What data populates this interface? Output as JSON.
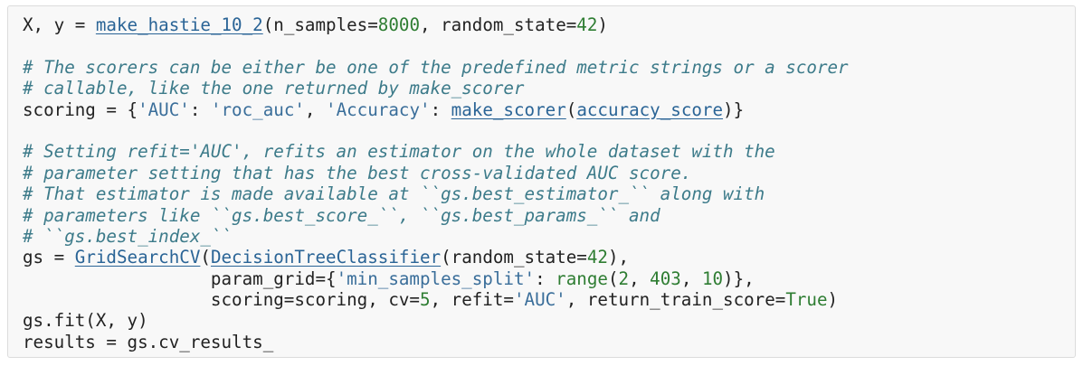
{
  "code": {
    "lines": [
      [
        {
          "t": "X, y = ",
          "k": "plain"
        },
        {
          "t": "make_hastie_10_2",
          "k": "link"
        },
        {
          "t": "(n_samples=",
          "k": "plain"
        },
        {
          "t": "8000",
          "k": "number"
        },
        {
          "t": ", random_state=",
          "k": "plain"
        },
        {
          "t": "42",
          "k": "number"
        },
        {
          "t": ")",
          "k": "plain"
        }
      ],
      [],
      [
        {
          "t": "# The scorers can be either be one of the predefined metric strings or a scorer",
          "k": "comment"
        }
      ],
      [
        {
          "t": "# callable, like the one returned by make_scorer",
          "k": "comment"
        }
      ],
      [
        {
          "t": "scoring = {",
          "k": "plain"
        },
        {
          "t": "'AUC'",
          "k": "string"
        },
        {
          "t": ": ",
          "k": "plain"
        },
        {
          "t": "'roc_auc'",
          "k": "string"
        },
        {
          "t": ", ",
          "k": "plain"
        },
        {
          "t": "'Accuracy'",
          "k": "string"
        },
        {
          "t": ": ",
          "k": "plain"
        },
        {
          "t": "make_scorer",
          "k": "link"
        },
        {
          "t": "(",
          "k": "plain"
        },
        {
          "t": "accuracy_score",
          "k": "link"
        },
        {
          "t": ")}",
          "k": "plain"
        }
      ],
      [],
      [
        {
          "t": "# Setting refit='AUC', refits an estimator on the whole dataset with the",
          "k": "comment"
        }
      ],
      [
        {
          "t": "# parameter setting that has the best cross-validated AUC score.",
          "k": "comment"
        }
      ],
      [
        {
          "t": "# That estimator is made available at ``gs.best_estimator_`` along with",
          "k": "comment"
        }
      ],
      [
        {
          "t": "# parameters like ``gs.best_score_``, ``gs.best_params_`` and",
          "k": "comment"
        }
      ],
      [
        {
          "t": "# ``gs.best_index_``",
          "k": "comment"
        }
      ],
      [
        {
          "t": "gs = ",
          "k": "plain"
        },
        {
          "t": "GridSearchCV",
          "k": "link"
        },
        {
          "t": "(",
          "k": "plain"
        },
        {
          "t": "DecisionTreeClassifier",
          "k": "link"
        },
        {
          "t": "(random_state=",
          "k": "plain"
        },
        {
          "t": "42",
          "k": "number"
        },
        {
          "t": "),",
          "k": "plain"
        }
      ],
      [
        {
          "t": "                  param_grid={",
          "k": "plain"
        },
        {
          "t": "'min_samples_split'",
          "k": "string"
        },
        {
          "t": ": ",
          "k": "plain"
        },
        {
          "t": "range",
          "k": "builtin"
        },
        {
          "t": "(",
          "k": "plain"
        },
        {
          "t": "2",
          "k": "number"
        },
        {
          "t": ", ",
          "k": "plain"
        },
        {
          "t": "403",
          "k": "number"
        },
        {
          "t": ", ",
          "k": "plain"
        },
        {
          "t": "10",
          "k": "number"
        },
        {
          "t": ")},",
          "k": "plain"
        }
      ],
      [
        {
          "t": "                  scoring=scoring, cv=",
          "k": "plain"
        },
        {
          "t": "5",
          "k": "number"
        },
        {
          "t": ", refit=",
          "k": "plain"
        },
        {
          "t": "'AUC'",
          "k": "string"
        },
        {
          "t": ", return_train_score=",
          "k": "plain"
        },
        {
          "t": "True",
          "k": "builtin"
        },
        {
          "t": ")",
          "k": "plain"
        }
      ],
      [
        {
          "t": "gs.fit(X, y)",
          "k": "plain"
        }
      ],
      [
        {
          "t": "results = gs.cv_results_",
          "k": "plain"
        }
      ]
    ]
  }
}
